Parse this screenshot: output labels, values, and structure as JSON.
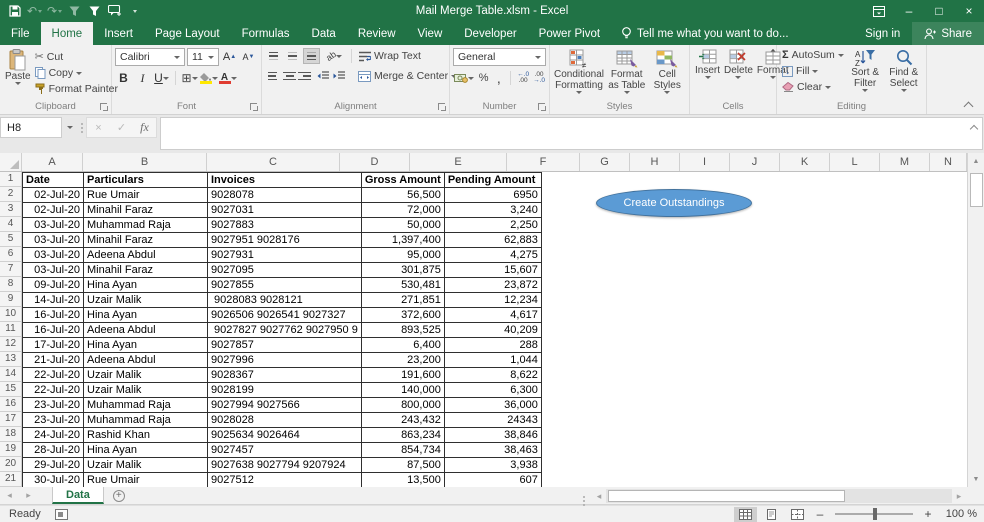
{
  "window": {
    "title": "Mail Merge Table.xlsm - Excel"
  },
  "tabs": {
    "items": [
      "File",
      "Home",
      "Insert",
      "Page Layout",
      "Formulas",
      "Data",
      "Review",
      "View",
      "Developer",
      "Power Pivot"
    ],
    "active": "Home",
    "tell_me": "Tell me what you want to do...",
    "sign_in": "Sign in",
    "share": "Share"
  },
  "ribbon": {
    "clipboard": {
      "label": "Clipboard",
      "paste": "Paste",
      "cut": "Cut",
      "copy": "Copy",
      "format_painter": "Format Painter"
    },
    "font": {
      "label": "Font",
      "family": "Calibri",
      "size": "11"
    },
    "alignment": {
      "label": "Alignment",
      "wrap_text": "Wrap Text",
      "merge_center": "Merge & Center"
    },
    "number": {
      "label": "Number",
      "format": "General"
    },
    "styles": {
      "label": "Styles",
      "conditional": "Conditional Formatting",
      "format_table": "Format as Table",
      "cell_styles": "Cell Styles"
    },
    "cells": {
      "label": "Cells",
      "insert": "Insert",
      "delete": "Delete",
      "format": "Format"
    },
    "editing": {
      "label": "Editing",
      "autosum": "AutoSum",
      "fill": "Fill",
      "clear": "Clear",
      "sort_filter": "Sort & Filter",
      "find_select": "Find & Select"
    }
  },
  "formula_bar": {
    "name_box": "H8",
    "formula": ""
  },
  "grid": {
    "columns": [
      "A",
      "B",
      "C",
      "D",
      "E",
      "F",
      "G",
      "H",
      "I",
      "J",
      "K",
      "L",
      "M",
      "N"
    ],
    "row_count": 21
  },
  "table": {
    "headers": [
      "Date",
      "Particulars",
      "Invoices",
      "Gross Amount",
      "Pending Amount"
    ],
    "rows": [
      [
        "02-Jul-20",
        "Rue Umair",
        "9028078",
        "56,500",
        "6950"
      ],
      [
        "02-Jul-20",
        "Minahil Faraz",
        "9027031",
        "72,000",
        "3,240"
      ],
      [
        "03-Jul-20",
        "Muhammad Raja",
        "9027883",
        "50,000",
        "2,250"
      ],
      [
        "03-Jul-20",
        "Minahil Faraz",
        "9027951 9028176",
        "1,397,400",
        "62,883"
      ],
      [
        "03-Jul-20",
        "Adeena Abdul",
        "9027931",
        "95,000",
        "4,275"
      ],
      [
        "03-Jul-20",
        "Minahil Faraz",
        "9027095",
        "301,875",
        "15,607"
      ],
      [
        "09-Jul-20",
        "Hina Ayan",
        "9027855",
        "530,481",
        "23,872"
      ],
      [
        "14-Jul-20",
        "Uzair Malik",
        " 9028083 9028121",
        "271,851",
        "12,234"
      ],
      [
        "16-Jul-20",
        "Hina Ayan",
        "9026506 9026541 9027327",
        "372,600",
        "4,617"
      ],
      [
        "16-Jul-20",
        "Adeena Abdul",
        " 9027827 9027762 9027950 9",
        "893,525",
        "40,209"
      ],
      [
        "17-Jul-20",
        "Hina Ayan",
        "9027857",
        "6,400",
        "288"
      ],
      [
        "21-Jul-20",
        "Adeena Abdul",
        "9027996",
        "23,200",
        "1,044"
      ],
      [
        "22-Jul-20",
        "Uzair Malik",
        "9028367",
        "191,600",
        "8,622"
      ],
      [
        "22-Jul-20",
        "Uzair Malik",
        "9028199",
        "140,000",
        "6,300"
      ],
      [
        "23-Jul-20",
        "Muhammad Raja",
        "9027994 9027566",
        "800,000",
        "36,000"
      ],
      [
        "23-Jul-20",
        "Muhammad Raja",
        "9028028",
        "243,432",
        "24343"
      ],
      [
        "24-Jul-20",
        "Rashid Khan",
        "9025634 9026464",
        "863,234",
        "38,846"
      ],
      [
        "28-Jul-20",
        "Hina Ayan",
        "9027457",
        "854,734",
        "38,463"
      ],
      [
        "29-Jul-20",
        "Uzair Malik",
        "9027638 9027794 9207924",
        "87,500",
        "3,938"
      ],
      [
        "30-Jul-20",
        "Rue Umair",
        "9027512",
        "13,500",
        "607"
      ]
    ]
  },
  "macro_button": {
    "label": "Create Outstandings",
    "fill": "#5b9bd5",
    "border": "#41719c"
  },
  "sheet_tabs": {
    "active": "Data"
  },
  "status": {
    "mode": "Ready",
    "zoom": "100 %"
  },
  "colors": {
    "brand_green": "#217346",
    "ribbon_bg": "#f1f1f1",
    "button_blue": "#5b9bd5"
  },
  "icons": {
    "undo": "↶",
    "redo": "↷",
    "minimize": "–",
    "maximize": "□",
    "close": "×",
    "cut": "✂",
    "autosum": "Σ",
    "borders": "⊞",
    "fill_down": "↓",
    "percent": "%",
    "comma": ",",
    "cancel": "×",
    "enter": "✓",
    "fx": "fx",
    "bold": "B",
    "italic": "I",
    "underline": "U",
    "font_grow": "A",
    "font_shrink": "A",
    "font_color": "A",
    "orientation": "ab",
    "scroll_up": "▲",
    "scroll_down": "▼",
    "scroll_left": "◂",
    "scroll_right": "▸",
    "prev_sheet": "◂",
    "next_sheet": "▸",
    "add_sheet": "+",
    "zoom_out": "–",
    "zoom_in": "+",
    "inc_dec_1": "←.0",
    "inc_dec_2": ".00",
    "dec_dec_1": ".00",
    "dec_dec_2": "→.0"
  }
}
